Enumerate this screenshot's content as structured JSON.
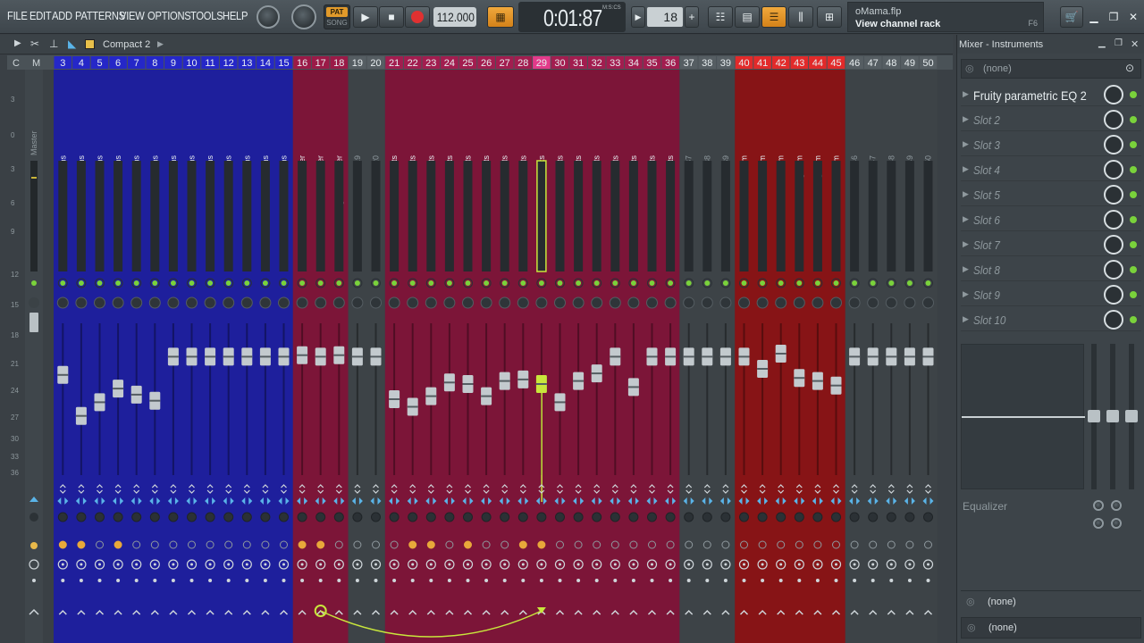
{
  "menu": [
    "FILE",
    "EDIT",
    "ADD",
    "PATTERNS",
    "VIEW",
    "OPTIONS",
    "TOOLS",
    "HELP"
  ],
  "transport": {
    "pat_label": "PAT",
    "song_label": "SONG",
    "tempo": "112.000",
    "time": "0:01:87",
    "time_unit": "M:S:CS",
    "pattern_number": "18"
  },
  "hint": {
    "project": "oMama.flp",
    "tooltip": "View channel rack",
    "shortcut": "F6"
  },
  "subbar": {
    "layout": "Compact 2"
  },
  "colors": {
    "blue": "#1e1f9c",
    "maroon": "#7c1538",
    "red": "#871416",
    "gray": "#3d4347",
    "accent": "#c8e63c",
    "track_num_pink": "#e33a8a",
    "track_num_red": "#e22a2a"
  },
  "mixer": {
    "master_label": "Master",
    "left_labels": [
      "C",
      "M"
    ],
    "db_scale": [
      "3",
      "0",
      "3",
      "6",
      "9",
      "12",
      "15",
      "18",
      "21",
      "24",
      "27",
      "30",
      "33",
      "36"
    ],
    "tracks": [
      {
        "n": "3",
        "name": "drums",
        "g": "blue",
        "vol": 0.66
      },
      {
        "n": "4",
        "name": "drums",
        "g": "blue",
        "vol": 0.39
      },
      {
        "n": "5",
        "name": "drums",
        "g": "blue",
        "vol": 0.48
      },
      {
        "n": "6",
        "name": "drums",
        "g": "blue",
        "vol": 0.57
      },
      {
        "n": "7",
        "name": "drums",
        "g": "blue",
        "vol": 0.53
      },
      {
        "n": "8",
        "name": "drums",
        "g": "blue",
        "vol": 0.49
      },
      {
        "n": "9",
        "name": "drums",
        "g": "blue",
        "vol": 0.78
      },
      {
        "n": "10",
        "name": "drums",
        "g": "blue",
        "vol": 0.78
      },
      {
        "n": "11",
        "name": "drums",
        "g": "blue",
        "vol": 0.78
      },
      {
        "n": "12",
        "name": "drums",
        "g": "blue",
        "vol": 0.78
      },
      {
        "n": "13",
        "name": "drums",
        "g": "blue",
        "vol": 0.78
      },
      {
        "n": "14",
        "name": "drums",
        "g": "blue",
        "vol": 0.78
      },
      {
        "n": "15",
        "name": "drums",
        "g": "blue",
        "vol": 0.78
      },
      {
        "n": "16",
        "name": "drums master",
        "g": "maroon",
        "vol": 0.79
      },
      {
        "n": "17",
        "name": "Instruments master",
        "g": "maroon",
        "vol": 0.78
      },
      {
        "n": "18",
        "name": "Logdrum master",
        "g": "maroon",
        "vol": 0.79
      },
      {
        "n": "19",
        "name": "Insert 19",
        "g": "gray",
        "vol": 0.78
      },
      {
        "n": "20",
        "name": "Insert 20",
        "g": "gray",
        "vol": 0.78
      },
      {
        "n": "21",
        "name": "Instruments",
        "g": "maroon",
        "vol": 0.5
      },
      {
        "n": "22",
        "name": "Instruments",
        "g": "maroon",
        "vol": 0.45
      },
      {
        "n": "23",
        "name": "Instruments",
        "g": "maroon",
        "vol": 0.52
      },
      {
        "n": "24",
        "name": "Instruments",
        "g": "maroon",
        "vol": 0.61
      },
      {
        "n": "25",
        "name": "Instruments",
        "g": "maroon",
        "vol": 0.6
      },
      {
        "n": "26",
        "name": "Instruments",
        "g": "maroon",
        "vol": 0.52
      },
      {
        "n": "27",
        "name": "Instruments",
        "g": "maroon",
        "vol": 0.62
      },
      {
        "n": "28",
        "name": "Instruments",
        "g": "maroon",
        "vol": 0.63
      },
      {
        "n": "29",
        "name": "Instruments",
        "g": "maroon",
        "vol": 0.6,
        "selected": true
      },
      {
        "n": "30",
        "name": "Instruments",
        "g": "maroon",
        "vol": 0.48
      },
      {
        "n": "31",
        "name": "Instruments",
        "g": "maroon",
        "vol": 0.62
      },
      {
        "n": "32",
        "name": "Instruments",
        "g": "maroon",
        "vol": 0.67
      },
      {
        "n": "33",
        "name": "Instruments",
        "g": "maroon",
        "vol": 0.78
      },
      {
        "n": "34",
        "name": "Instruments",
        "g": "maroon",
        "vol": 0.58
      },
      {
        "n": "35",
        "name": "Instruments",
        "g": "maroon",
        "vol": 0.78
      },
      {
        "n": "36",
        "name": "Instruments",
        "g": "maroon",
        "vol": 0.78
      },
      {
        "n": "37",
        "name": "Insert 37",
        "g": "gray",
        "vol": 0.78
      },
      {
        "n": "38",
        "name": "Insert 38",
        "g": "gray",
        "vol": 0.78
      },
      {
        "n": "39",
        "name": "Insert 39",
        "g": "gray",
        "vol": 0.78
      },
      {
        "n": "40",
        "name": "Logdrum",
        "g": "red",
        "vol": 0.78
      },
      {
        "n": "41",
        "name": "Logdrum",
        "g": "red",
        "vol": 0.7
      },
      {
        "n": "42",
        "name": "Logdrum",
        "g": "red",
        "vol": 0.8
      },
      {
        "n": "43",
        "name": "Logdrum",
        "g": "red",
        "vol": 0.64
      },
      {
        "n": "44",
        "name": "Logdrum",
        "g": "red",
        "vol": 0.62
      },
      {
        "n": "45",
        "name": "Logdrum",
        "g": "red",
        "vol": 0.59
      },
      {
        "n": "46",
        "name": "Insert 46",
        "g": "gray",
        "vol": 0.78
      },
      {
        "n": "47",
        "name": "Insert 47",
        "g": "gray",
        "vol": 0.78
      },
      {
        "n": "48",
        "name": "Insert 48",
        "g": "gray",
        "vol": 0.78
      },
      {
        "n": "49",
        "name": "Insert 49",
        "g": "gray",
        "vol": 0.78
      },
      {
        "n": "50",
        "name": "Insert 50",
        "g": "gray",
        "vol": 0.78
      }
    ]
  },
  "effects_panel": {
    "title": "Mixer - Instruments",
    "input": "(none)",
    "slots": [
      "Fruity parametric EQ 2",
      "Slot 2",
      "Slot 3",
      "Slot 4",
      "Slot 5",
      "Slot 6",
      "Slot 7",
      "Slot 8",
      "Slot 9",
      "Slot 10"
    ],
    "eq_label": "Equalizer",
    "output_1": "(none)",
    "output_2": "(none)"
  }
}
